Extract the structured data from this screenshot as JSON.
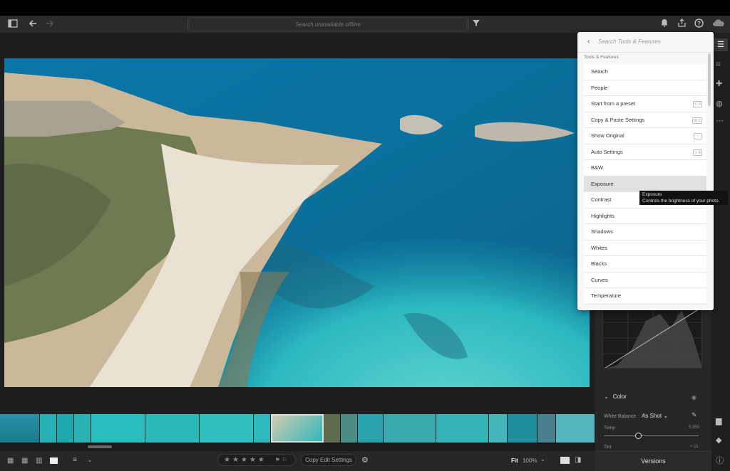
{
  "toolbar": {
    "search_placeholder": "Search unavailable offline",
    "icons": [
      "sidebar-toggle-icon",
      "back-arrow-icon",
      "forward-arrow-icon",
      "filter-icon",
      "bell-icon",
      "share-icon",
      "help-icon",
      "cloud-icon"
    ]
  },
  "tools_dropdown": {
    "search_placeholder": "Search Tools & Features",
    "section_label": "Tools & Features",
    "items": [
      {
        "label": "Search",
        "shortcut": ""
      },
      {
        "label": "People",
        "shortcut": ""
      },
      {
        "label": "Start from a preset",
        "shortcut": "⇧ P"
      },
      {
        "label": "Copy & Paste Settings",
        "shortcut": "⌘ C"
      },
      {
        "label": "Show Original",
        "shortcut": "\\"
      },
      {
        "label": "Auto Settings",
        "shortcut": "⇧ A"
      },
      {
        "label": "B&W",
        "shortcut": ""
      },
      {
        "label": "Exposure",
        "shortcut": ""
      },
      {
        "label": "Contrast",
        "shortcut": ""
      },
      {
        "label": "Highlights",
        "shortcut": ""
      },
      {
        "label": "Shadows",
        "shortcut": ""
      },
      {
        "label": "Whites",
        "shortcut": ""
      },
      {
        "label": "Blacks",
        "shortcut": ""
      },
      {
        "label": "Curves",
        "shortcut": ""
      },
      {
        "label": "Temperature",
        "shortcut": ""
      }
    ],
    "highlighted_item": "Exposure"
  },
  "tooltip": {
    "title": "Exposure",
    "description": "Controls the brightness of your photo."
  },
  "right_panel": {
    "color_section": "Color",
    "white_balance_label": "White Balance",
    "white_balance_value": "As Shot",
    "temp_label": "Temp",
    "temp_value": "5,350",
    "temp_fraction": 0.35,
    "tint_label": "Tint",
    "tint_value": "+ 11"
  },
  "bottom_bar": {
    "stars": "★★★★★",
    "copy_edit_settings": "Copy Edit Settings",
    "fit_label": "Fit",
    "zoom": "100%",
    "versions": "Versions"
  },
  "colors": {
    "accent": "#2680eb",
    "panel_bg": "#262626",
    "dropdown_bg": "#f7f7f7",
    "highlight_row": "#e0e0e0"
  }
}
